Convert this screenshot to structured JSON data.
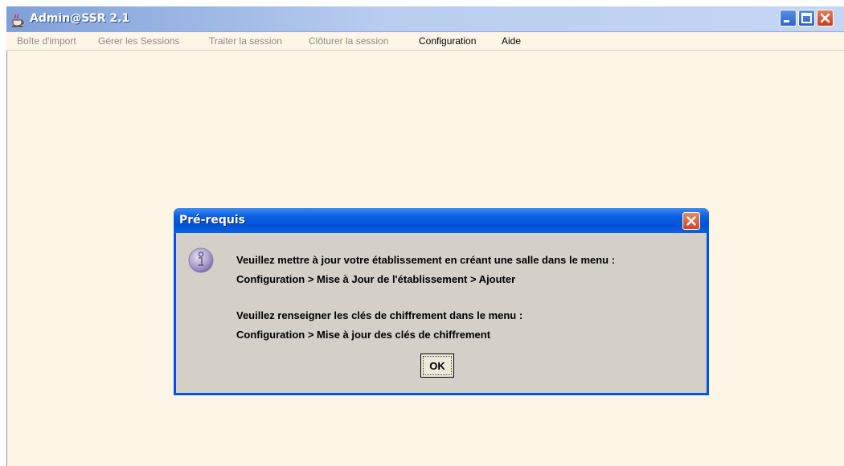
{
  "window": {
    "title": "Admin@SSR 2.1",
    "icons": {
      "app": "java-coffee-icon",
      "minimize": "minimize-icon",
      "maximize": "maximize-icon",
      "close": "close-icon"
    }
  },
  "menu": {
    "items": [
      {
        "label": "Boîte d'import",
        "enabled": false
      },
      {
        "label": "Gérer les Sessions",
        "enabled": false
      },
      {
        "label": "Traiter la session",
        "enabled": false
      },
      {
        "label": "Clôturer la session",
        "enabled": false
      },
      {
        "label": "Configuration",
        "enabled": true
      },
      {
        "label": "Aide",
        "enabled": true
      }
    ]
  },
  "dialog": {
    "title": "Pré-requis",
    "icon": "info-icon",
    "lines": [
      "Veuillez mettre à jour votre établissement en créant une salle dans le menu :",
      "Configuration > Mise à Jour de l'établissement > Ajouter",
      "Veuillez renseigner les clés de chiffrement dans le menu :",
      "Configuration > Mise à jour des clés de chiffrement"
    ],
    "ok_label": "OK"
  },
  "colors": {
    "background": "#fdf5e6",
    "dialog_frame": "#0054e3",
    "dialog_body": "#d4d0c8",
    "menu_disabled": "#8c8c8c"
  }
}
